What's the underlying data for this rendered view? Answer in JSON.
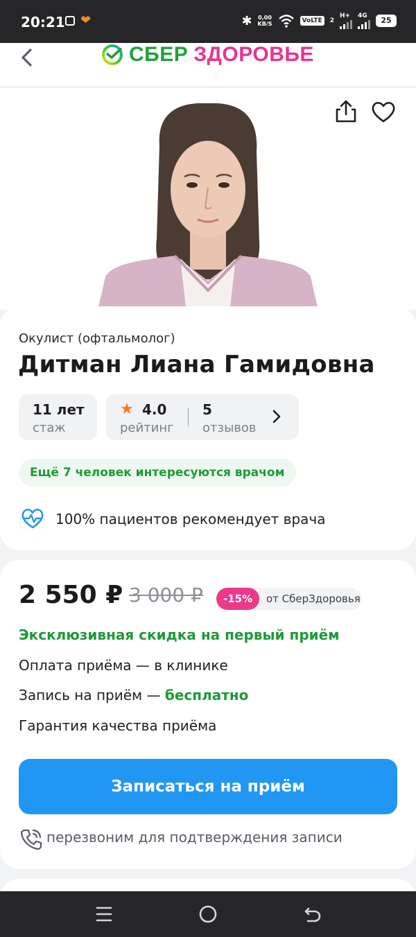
{
  "status_bar": {
    "time": "20:21",
    "net_speed_value": "0,00",
    "net_speed_unit": "KB/S",
    "volte": "VoLTE",
    "sim2": "2",
    "net1": "H+",
    "net2": "4G",
    "battery": "25"
  },
  "header": {
    "logo_left": "СБЕР",
    "logo_right": "ЗДОРОВЬЕ"
  },
  "doctor": {
    "specialty": "Окулист (офтальмолог)",
    "name": "Дитман Лиана Гамидовна",
    "experience_value": "11 лет",
    "experience_label": "стаж",
    "rating_value": "4.0",
    "rating_label": "рейтинг",
    "reviews_value": "5",
    "reviews_label": "отзывов",
    "interest": "Ещё 7 человек интересуются врачом",
    "recommend": "100% пациентов рекомендует врача"
  },
  "pricing": {
    "price": "2 550 ₽",
    "old_price": "3 000 ₽",
    "discount": "-15%",
    "discount_from": "от СберЗдоровья",
    "exclusive": "Эксклюзивная скидка на первый приём",
    "payment": "Оплата приёма — в клинике",
    "booking_prefix": "Запись на приём — ",
    "booking_free": "бесплатно",
    "guarantee": "Гарантия качества приёма",
    "book_button": "Записаться на приём",
    "callback": "перезвоним для подтверждения записи"
  },
  "colors": {
    "accent_blue": "#2197f3",
    "brand_green": "#21a038",
    "brand_pink": "#e8338f",
    "discount_pink": "#ea3a89",
    "star_orange": "#f27b21"
  }
}
